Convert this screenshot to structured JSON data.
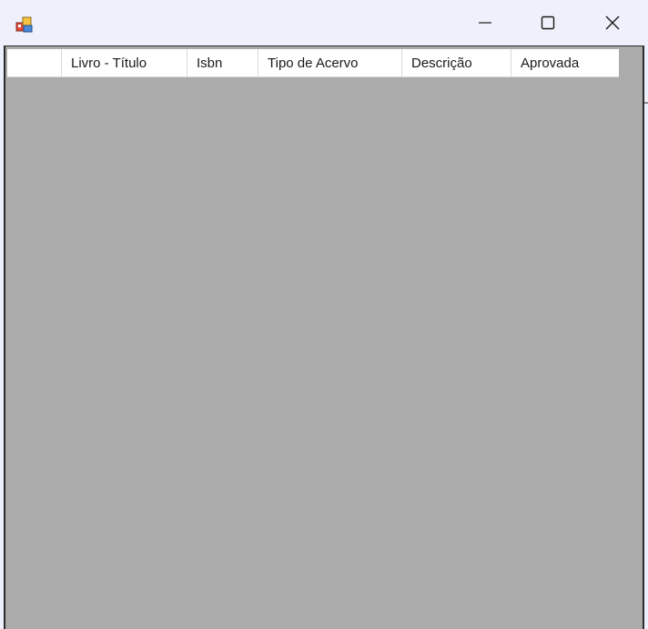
{
  "window": {
    "title": "",
    "controls": {
      "minimize": "minimize-icon",
      "maximize": "maximize-icon",
      "close": "close-icon"
    }
  },
  "grid": {
    "columns": [
      {
        "label": ""
      },
      {
        "label": "Livro - Título"
      },
      {
        "label": "Isbn"
      },
      {
        "label": "Tipo de Acervo"
      },
      {
        "label": "Descrição"
      },
      {
        "label": "Aprovada"
      }
    ],
    "rows": []
  },
  "colors": {
    "titlebar": "#eef1fb",
    "client_background": "#ababab",
    "header_background": "#ffffff",
    "border": "#2b2b2b"
  }
}
